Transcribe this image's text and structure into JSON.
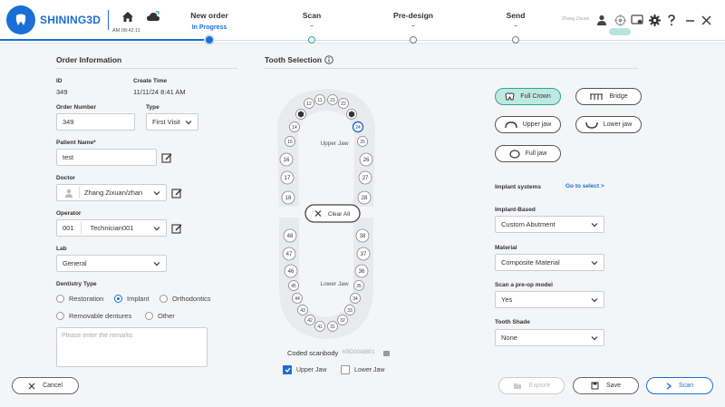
{
  "app": {
    "brand": "SHINING3D",
    "clock": "AM 08:42:11",
    "user": "Zhang Zixuan"
  },
  "steps": [
    {
      "label": "New order",
      "status": "In Progress"
    },
    {
      "label": "Scan",
      "status": "-"
    },
    {
      "label": "Pre-design",
      "status": "-"
    },
    {
      "label": "Send",
      "status": "-"
    }
  ],
  "order": {
    "title": "Order Information",
    "id_label": "ID",
    "id_value": "349",
    "create_label": "Create Time",
    "create_value": "11/11/24 8:41 AM",
    "number_label": "Order Number",
    "number_value": "349",
    "type_label": "Type",
    "type_value": "First Visit",
    "patient_label": "Patient Name*",
    "patient_value": "test",
    "doctor_label": "Doctor",
    "doctor_value": "Zhang Zixuan/zhan",
    "operator_label": "Operator",
    "operator_code": "001",
    "operator_value": "Technician001",
    "lab_label": "Lab",
    "lab_value": "General",
    "dentistry_label": "Dentistry Type",
    "dentistry_options": [
      "Restoration",
      "Implant",
      "Orthodontics",
      "Removable dentures",
      "Other"
    ],
    "dentistry_selected": "Implant",
    "remarks_placeholder": "Please enter the remarks"
  },
  "tooth": {
    "title": "Tooth Selection",
    "upper_label": "Upper Jaw",
    "lower_label": "Lower Jaw",
    "clear_all": "Clear All",
    "upper_teeth": [
      "18",
      "17",
      "16",
      "15",
      "14",
      "13",
      "12",
      "11",
      "21",
      "22",
      "23",
      "24",
      "25",
      "26",
      "27",
      "28"
    ],
    "lower_teeth": [
      "48",
      "47",
      "46",
      "45",
      "44",
      "43",
      "42",
      "41",
      "31",
      "32",
      "33",
      "34",
      "35",
      "36",
      "37",
      "38"
    ],
    "coded_label": "Coded scanbody",
    "coded_value": "KBD0048801",
    "upper_jaw_check": "Upper Jaw",
    "lower_jaw_check": "Lower Jaw"
  },
  "restoration": {
    "full_crown": "Full Crown",
    "bridge": "Bridge",
    "upper_jaw": "Upper jaw",
    "lower_jaw": "Lower jaw",
    "full_jaw": "Full jaw",
    "implant_systems": "Implant systems",
    "go_select": "Go to select >",
    "implant_based_label": "Implant-Based",
    "implant_based_value": "Custom Abutment",
    "material_label": "Material",
    "material_value": "Composite Material",
    "preop_label": "Scan a pre-op model",
    "preop_value": "Yes",
    "shade_label": "Tooth Shade",
    "shade_value": "None"
  },
  "footer": {
    "cancel": "Cancel",
    "explore": "Explore",
    "save": "Save",
    "scan": "Scan"
  },
  "colors": {
    "accent": "#1a6fd6",
    "teal": "#2aa79b",
    "selected_bg": "#bfe8e3"
  }
}
